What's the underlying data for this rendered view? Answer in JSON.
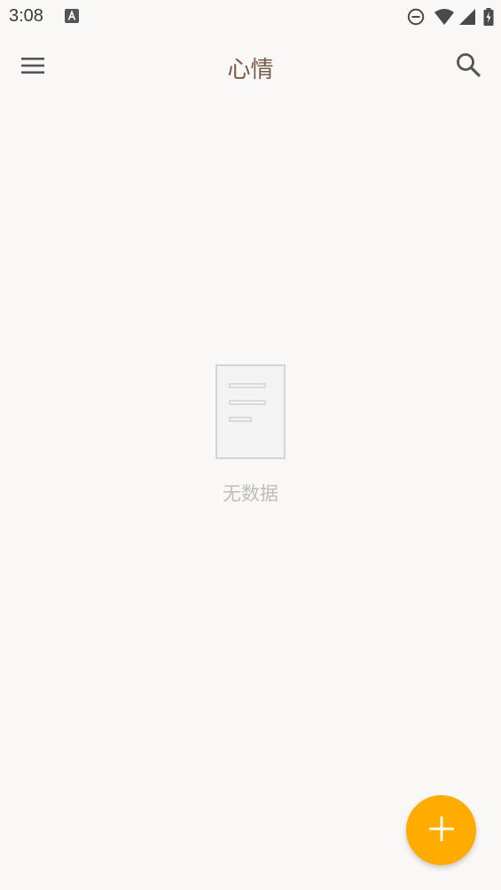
{
  "status_bar": {
    "time": "3:08",
    "app_icon": "text-a-icon",
    "icons": [
      "do-not-disturb-icon",
      "wifi-icon",
      "cell-signal-icon",
      "battery-charging-icon"
    ]
  },
  "app_bar": {
    "title": "心情",
    "menu_icon": "hamburger-menu-icon",
    "search_icon": "search-icon"
  },
  "empty_state": {
    "icon": "empty-document-icon",
    "text": "无数据"
  },
  "fab": {
    "icon": "plus-icon"
  },
  "colors": {
    "background": "#f9f8f6",
    "title": "#7a5a4a",
    "empty_text": "#bdbdbd",
    "fab": "#ffab00",
    "icon": "#555555"
  }
}
